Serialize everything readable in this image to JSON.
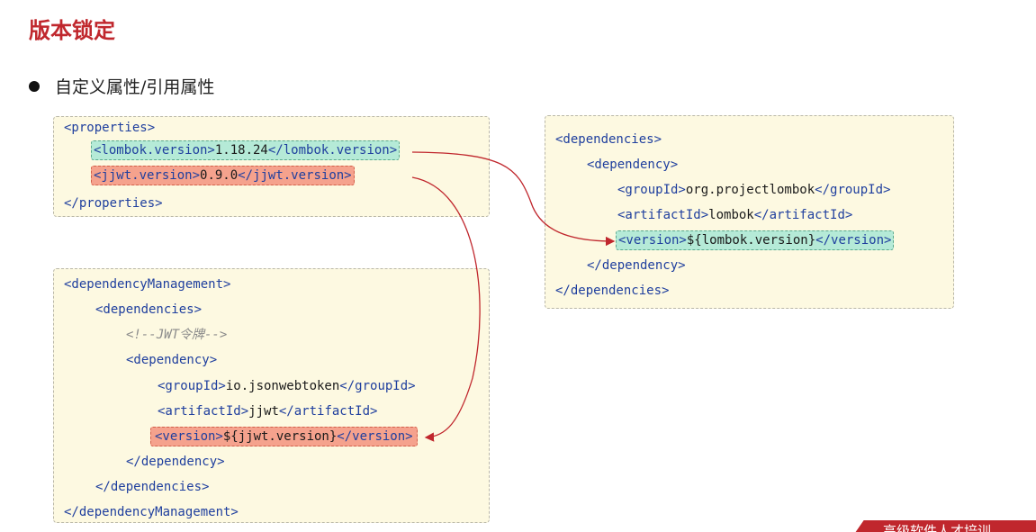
{
  "slide": {
    "title": "版本锁定",
    "bullet": "自定义属性/引用属性",
    "brand": "高级软件人才培训"
  },
  "colors": {
    "title_red": "#c0272d",
    "box_bg": "#fdf9e1",
    "tag_blue": "#1f3f9e",
    "highlight_green": "#b5ead7",
    "highlight_red": "#f5a28d",
    "arrow_red": "#c0272d"
  },
  "properties_box": {
    "open_tag": "<properties>",
    "lombok_open": "<lombok.version>",
    "lombok_value": "1.18.24",
    "lombok_close": "</lombok.version>",
    "jjwt_open": "<jjwt.version>",
    "jjwt_value": "0.9.0",
    "jjwt_close": "</jjwt.version>",
    "close_tag": "</properties>"
  },
  "dm_box": {
    "dm_open": "<dependencyManagement>",
    "deps_open": "<dependencies>",
    "comment": "<!--JWT令牌-->",
    "dep_open": "<dependency>",
    "group_open": "<groupId>",
    "group_value": "io.jsonwebtoken",
    "group_close": "</groupId>",
    "artifact_open": "<artifactId>",
    "artifact_value": "jjwt",
    "artifact_close": "</artifactId>",
    "version_open": "<version>",
    "version_value": "${jjwt.version}",
    "version_close": "</version>",
    "dep_close": "</dependency>",
    "deps_close": "</dependencies>",
    "dm_close": "</dependencyManagement>"
  },
  "deps_box": {
    "deps_open": "<dependencies>",
    "dep_open": "<dependency>",
    "group_open": "<groupId>",
    "group_value": "org.projectlombok",
    "group_close": "</groupId>",
    "artifact_open": "<artifactId>",
    "artifact_value": "lombok",
    "artifact_close": "</artifactId>",
    "version_open": "<version>",
    "version_value": "${lombok.version}",
    "version_close": "</version>",
    "dep_close": "</dependency>",
    "deps_close": "</dependencies>"
  }
}
